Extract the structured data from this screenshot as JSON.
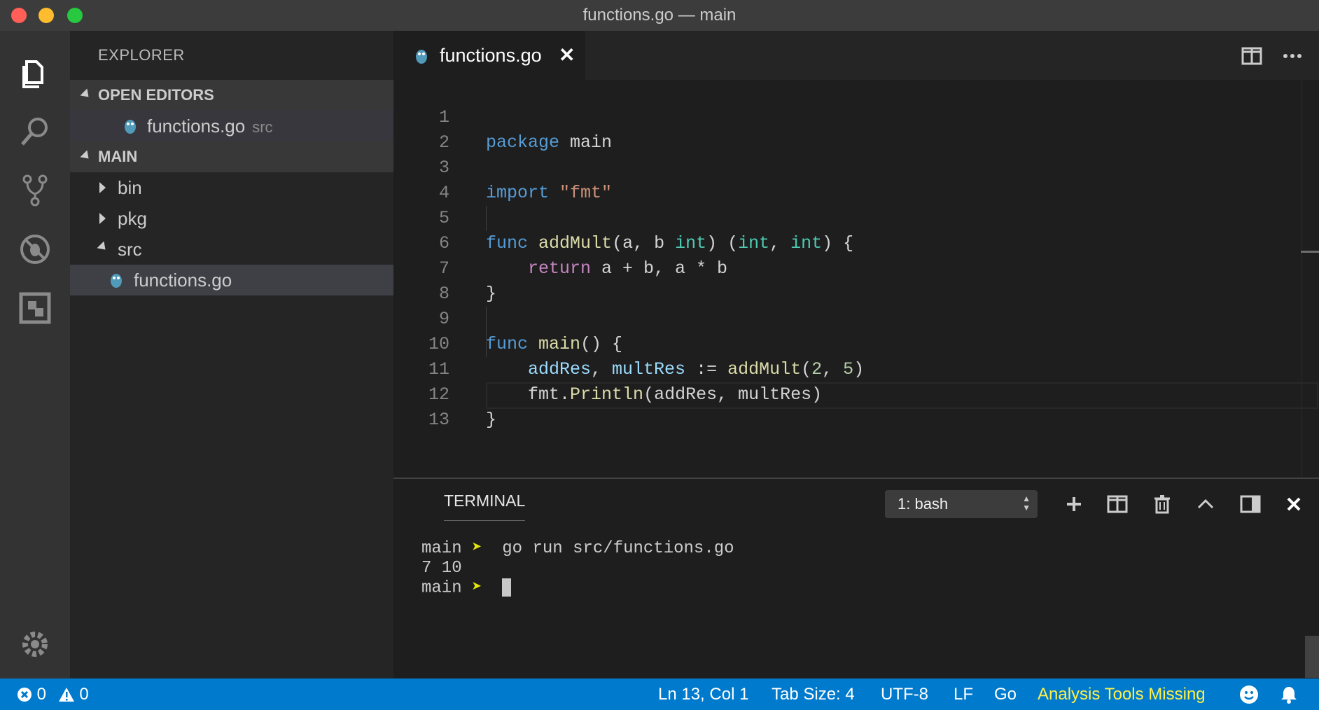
{
  "window": {
    "title": "functions.go — main"
  },
  "activity_bar": {
    "icons": [
      "files-icon",
      "search-icon",
      "source-control-icon",
      "debug-icon",
      "extensions-icon",
      "gear-icon"
    ]
  },
  "sidebar": {
    "title": "EXPLORER",
    "open_editors": {
      "header": "OPEN EDITORS",
      "items": [
        {
          "name": "functions.go",
          "folder": "src"
        }
      ]
    },
    "main": {
      "header": "MAIN",
      "items": [
        {
          "name": "bin",
          "type": "folder",
          "expanded": false
        },
        {
          "name": "pkg",
          "type": "folder",
          "expanded": false
        },
        {
          "name": "src",
          "type": "folder",
          "expanded": true
        },
        {
          "name": "functions.go",
          "type": "file",
          "selected": true
        }
      ]
    }
  },
  "editor": {
    "tab": {
      "label": "functions.go",
      "close": "✕"
    },
    "line_numbers": [
      "1",
      "2",
      "3",
      "4",
      "5",
      "6",
      "7",
      "8",
      "9",
      "10",
      "11",
      "12",
      "13"
    ],
    "code": {
      "l1": {
        "kw": "package",
        "rest": " main"
      },
      "l3": {
        "kw": "import",
        "str": "\"fmt\""
      },
      "l5": {
        "kw": "func",
        "fn": "addMult",
        "p1": "(a, b ",
        "t1": "int",
        "p2": ") (",
        "t2": "int",
        "p3": ", ",
        "t3": "int",
        "p4": ") {"
      },
      "l6": {
        "kw": "return",
        "rest": " a + b, a * b"
      },
      "l7": "}",
      "l9": {
        "kw": "func",
        "fn": "main",
        "rest": "() {"
      },
      "l10": {
        "v1": "addRes",
        "sep": ", ",
        "v2": "multRes",
        "op": " := ",
        "fn": "addMult",
        "p1": "(",
        "n1": "2",
        "c": ", ",
        "n2": "5",
        "p2": ")"
      },
      "l11": {
        "obj": "fmt.",
        "fn": "Println",
        "args": "(addRes, multRes)"
      },
      "l12": "}"
    }
  },
  "panel": {
    "title": "TERMINAL",
    "terminal_select": "1: bash",
    "lines": [
      {
        "dir": "main",
        "prompt": "➤",
        "cmd": "go run src/functions.go"
      },
      {
        "output": "7 10"
      },
      {
        "dir": "main",
        "prompt": "➤",
        "cmd": ""
      }
    ]
  },
  "statusbar": {
    "errors": "0",
    "warnings": "0",
    "position": "Ln 13, Col 1",
    "tab_size": "Tab Size: 4",
    "encoding": "UTF-8",
    "eol": "LF",
    "language": "Go",
    "analysis": "Analysis Tools Missing"
  },
  "colors": {
    "accent": "#007acc",
    "warning_text": "#fff04a",
    "prompt": "#e5e510"
  }
}
